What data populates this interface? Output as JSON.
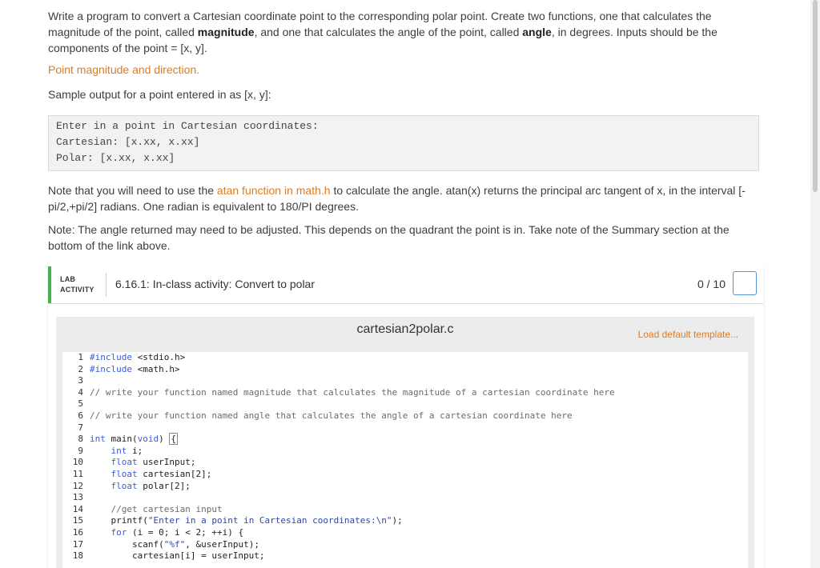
{
  "intro": {
    "t1": "Write a program to convert a Cartesian coordinate point to the corresponding polar point. Create two functions, one that calculates the magnitude of the point, called ",
    "magnitude": "magnitude",
    "t2": ", and one that calculates the angle of the point, called ",
    "angle": "angle",
    "t3": ", in degrees. Inputs should be the components of the point = [x, y]."
  },
  "point_link": "Point magnitude and direction.",
  "sample_label": "Sample output for a point entered in as [x, y]:",
  "sample_output": [
    "Enter in a point in Cartesian coordinates:",
    "Cartesian: [x.xx, x.xx]",
    "Polar: [x.xx, x.xx]"
  ],
  "note1": {
    "pre": "Note that you will need to use the ",
    "link": "atan function in math.h",
    "post": " to calculate the angle. atan(x) returns the principal arc tangent of x, in the interval [-pi/2,+pi/2] radians. One radian is equivalent to 180/PI degrees."
  },
  "note2": "Note: The angle returned may need to be adjusted. This depends on the quadrant the point is in. Take note of the Summary section at the bottom of the link above.",
  "lab": {
    "tag_line1": "LAB",
    "tag_line2": "ACTIVITY",
    "title": "6.16.1: In-class activity: Convert to polar",
    "score": "0 / 10"
  },
  "editor": {
    "filename": "cartesian2polar.c",
    "load_template": "Load default template...",
    "line_numbers": [
      "1",
      "2",
      "3",
      "4",
      "5",
      "6",
      "7",
      "8",
      "9",
      "10",
      "11",
      "12",
      "13",
      "14",
      "15",
      "16",
      "17",
      "18"
    ],
    "code": {
      "l1_pp": "#include",
      "l1_rest": " <stdio.h>",
      "l2_pp": "#include",
      "l2_rest": " <math.h>",
      "l4": "// write your function named magnitude that calculates the magnitude of a cartesian coordinate here",
      "l6": "// write your function named angle that calculates the angle of a cartesian coordinate here",
      "l8_int": "int",
      "l8_main": " main(",
      "l8_void": "void",
      "l8_close": ") ",
      "l8_brace": "{",
      "l9_int": "int",
      "l9_rest": " i;",
      "l10_float": "float",
      "l10_rest": " userInput;",
      "l11_float": "float",
      "l11_rest": " cartesian[2];",
      "l12_float": "float",
      "l12_rest": " polar[2];",
      "l14": "//get cartesian input",
      "l15_fn": "printf(",
      "l15_str": "\"Enter in a point in Cartesian coordinates:\\n\"",
      "l15_end": ");",
      "l16_for": "for",
      "l16_rest": " (i = 0; i < 2; ++i) {",
      "l17_fn": "scanf(",
      "l17_str": "\"%f\"",
      "l17_rest": ", &userInput);",
      "l18": "cartesian[i] = userInput;"
    }
  },
  "colors": {
    "link": "#e07b1f",
    "lab_accent": "#4caf50",
    "checkbox_border": "#5a8fd6",
    "keyword": "#3b5bdb"
  }
}
